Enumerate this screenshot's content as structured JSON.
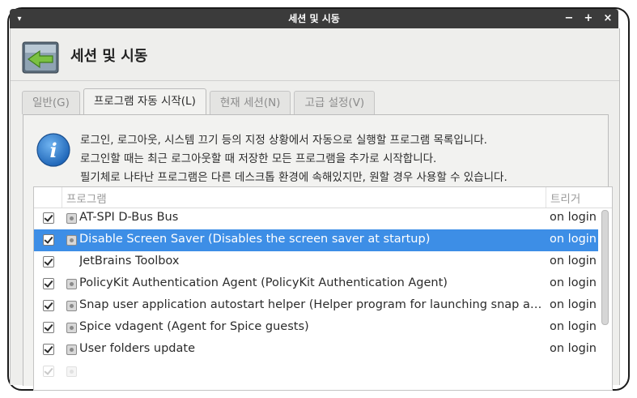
{
  "window": {
    "title": "세션 및 시동",
    "menu_glyph": "▾",
    "controls": {
      "minimize": "−",
      "maximize": "+",
      "close": "×"
    }
  },
  "header": {
    "title": "세션 및 시동",
    "icon": "session-startup-icon"
  },
  "tabs": [
    {
      "label": "일반(G)",
      "active": false
    },
    {
      "label": "프로그램 자동 시작(L)",
      "active": true
    },
    {
      "label": "현재 세션(N)",
      "active": false
    },
    {
      "label": "고급 설정(V)",
      "active": false
    }
  ],
  "info": {
    "icon": "info-icon",
    "lines": [
      "로그인, 로그아웃, 시스템 끄기 등의 지정 상황에서 자동으로 실행할 프로그램 목록입니다.",
      "로그인할 때는 최근 로그아웃할 때 저장한 모든 프로그램을 추가로 시작합니다.",
      "필기체로 나타난 프로그램은 다른 데스크톱 환경에 속해있지만, 원할 경우 사용할 수 있습니다."
    ]
  },
  "list": {
    "columns": {
      "program": "프로그램",
      "trigger": "트리거"
    },
    "rows": [
      {
        "checked": true,
        "icon": true,
        "name": "AT-SPI D-Bus Bus",
        "trigger": "on login",
        "selected": false
      },
      {
        "checked": true,
        "icon": true,
        "name": "Disable Screen Saver (Disables the screen saver at startup)",
        "trigger": "on login",
        "selected": true
      },
      {
        "checked": true,
        "icon": false,
        "name": "JetBrains Toolbox",
        "trigger": "on login",
        "selected": false
      },
      {
        "checked": true,
        "icon": true,
        "name": "PolicyKit Authentication Agent (PolicyKit Authentication Agent)",
        "trigger": "on login",
        "selected": false
      },
      {
        "checked": true,
        "icon": true,
        "name": "Snap user application autostart helper (Helper program for launching snap applications that are configured to start automatically)",
        "trigger": "on login",
        "selected": false
      },
      {
        "checked": true,
        "icon": true,
        "name": "Spice vdagent (Agent for Spice guests)",
        "trigger": "on login",
        "selected": false
      },
      {
        "checked": true,
        "icon": true,
        "name": "User folders update",
        "trigger": "on login",
        "selected": false
      }
    ]
  },
  "colors": {
    "titlebar": "#3b3b3b",
    "selection": "#3d8ee6",
    "background": "#eeeeec"
  }
}
